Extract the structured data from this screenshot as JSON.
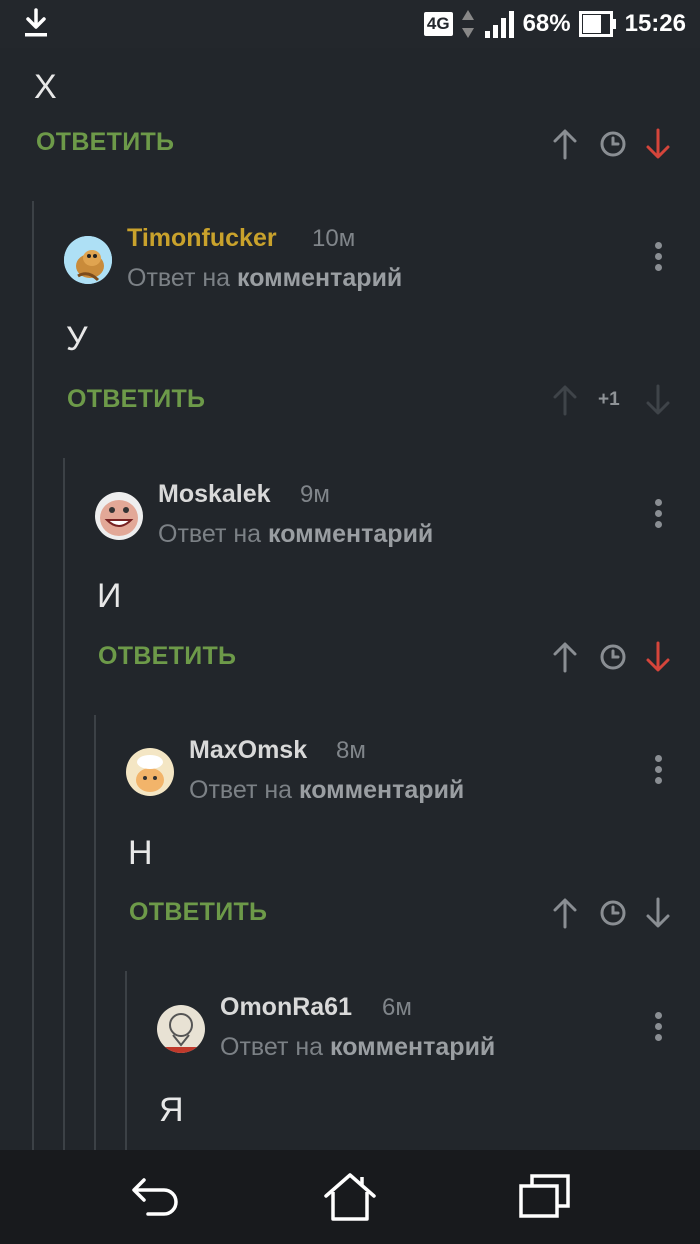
{
  "status_bar": {
    "network": "4G",
    "battery": "68%",
    "time": "15:26"
  },
  "top_comment": {
    "text": "Х",
    "reply_label": "ОТВЕТИТЬ"
  },
  "comments": [
    {
      "author": "Timonfucker",
      "time": "10м",
      "reply_prefix": "Ответ на",
      "reply_target": "комментарий",
      "text": "У",
      "reply_label": "ОТВЕТИТЬ",
      "score": "+1"
    },
    {
      "author": "Moskalek",
      "time": "9м",
      "reply_prefix": "Ответ на",
      "reply_target": "комментарий",
      "text": "И",
      "reply_label": "ОТВЕТИТЬ"
    },
    {
      "author": "MaxOmsk",
      "time": "8м",
      "reply_prefix": "Ответ на",
      "reply_target": "комментарий",
      "text": "Н",
      "reply_label": "ОТВЕТИТЬ"
    },
    {
      "author": "OmonRa61",
      "time": "6м",
      "reply_prefix": "Ответ на",
      "reply_target": "комментарий",
      "text": "Я"
    }
  ],
  "colors": {
    "accent_green": "#6d9a49",
    "downvote_red": "#d5453b",
    "author_gold": "#c9a22c",
    "background": "#22262b"
  },
  "icons": [
    "download-icon",
    "signal-icon",
    "battery-icon",
    "arrow-up-icon",
    "clock-icon",
    "arrow-down-icon",
    "more-vertical-icon",
    "back-icon",
    "home-icon",
    "recent-apps-icon"
  ]
}
